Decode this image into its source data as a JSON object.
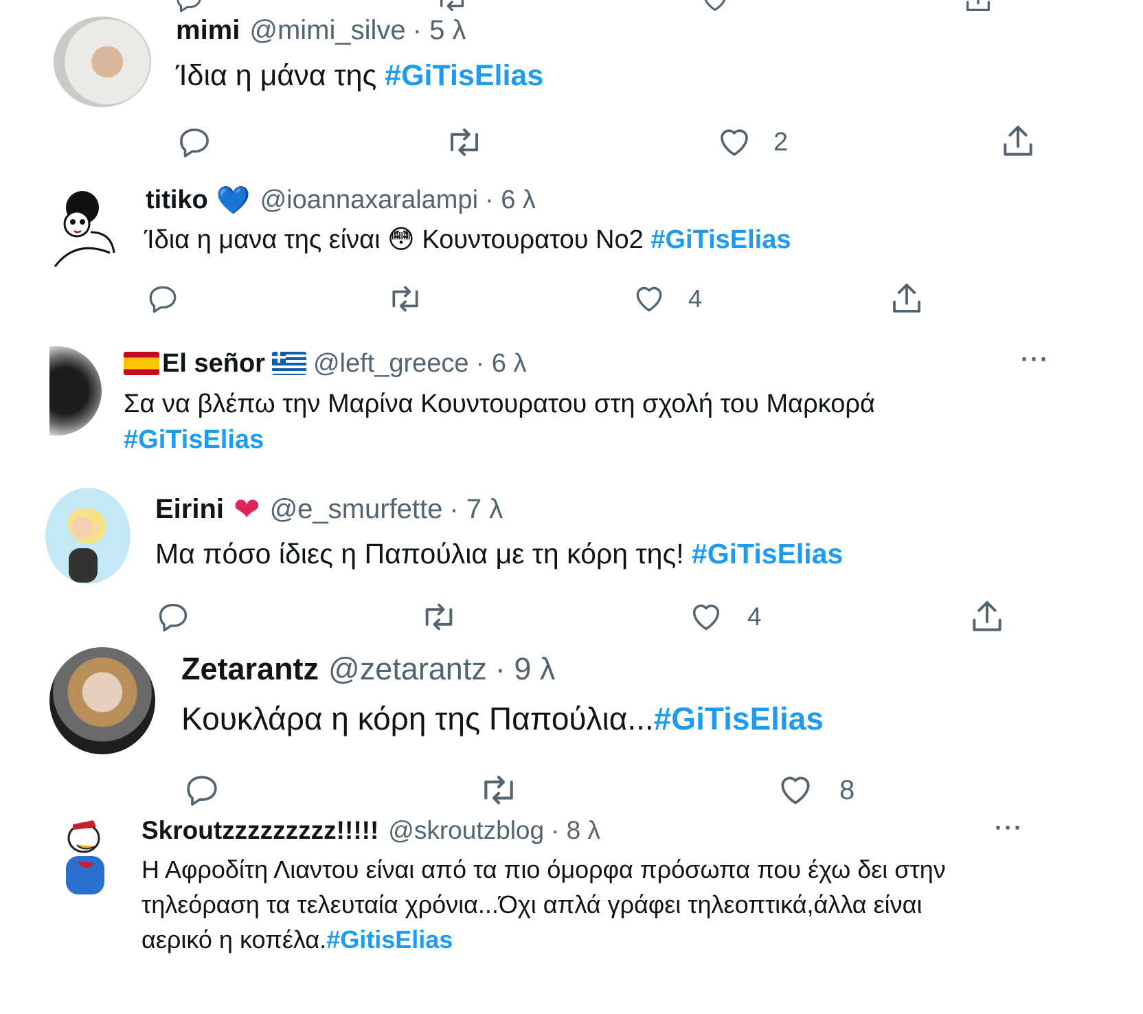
{
  "tweets": [
    {
      "name": "mimi",
      "handle": "@mimi_silve",
      "time": "· 5 λ",
      "text": "Ίδια η μάνα της ",
      "hashtag": "#GiTisElias",
      "likes": "2"
    },
    {
      "name": "titiko",
      "name_emoji": "💙",
      "handle": "@ioannaxaralampi",
      "time": "· 6 λ",
      "text": "Ίδια η μανα της είναι 😳 Κουντουρατου Νο2 ",
      "hashtag": "#GiTisElias",
      "likes": "4"
    },
    {
      "name": "El señor",
      "handle": "@left_greece",
      "time": "· 6 λ",
      "text": "Σα να βλέπω την Μαρίνα Κουντουρατου στη σχολή του Μαρκορά",
      "hashtag": "#GiTisElias",
      "more": "···"
    },
    {
      "name": "Eirini",
      "name_emoji": "❤",
      "handle": "@e_smurfette",
      "time": "· 7 λ",
      "text": "Μα πόσο ίδιες η Παπούλια με τη κόρη της!  ",
      "hashtag": "#GiTisElias",
      "likes": "4"
    },
    {
      "name": "Zetarantz",
      "handle": "@zetarantz",
      "time": "· 9 λ",
      "text": "Κουκλάρα η κόρη της Παπούλια...",
      "hashtag": "#GiTisElias",
      "likes": "8"
    },
    {
      "name": "Skroutzzzzzzzzz!!!!!",
      "handle": "@skroutzblog",
      "time": "· 8 λ",
      "text_line1": "Η Αφροδίτη Λιαντου είναι από τα πιο όμορφα πρόσωπα που έχω δει στην",
      "text_line2": "τηλεόραση τα τελευταία χρόνια...Όχι απλά γράφει τηλεοπτικά,άλλα είναι",
      "text_line3": "αερικό η κοπέλα.",
      "hashtag": "#GitisElias",
      "more": "···"
    }
  ],
  "icons": {
    "reply": "reply-icon",
    "retweet": "retweet-icon",
    "like": "heart-icon",
    "share": "share-icon"
  },
  "colors": {
    "hashtag": "#1d9bf0",
    "text": "#0f1419",
    "meta": "#536471"
  }
}
